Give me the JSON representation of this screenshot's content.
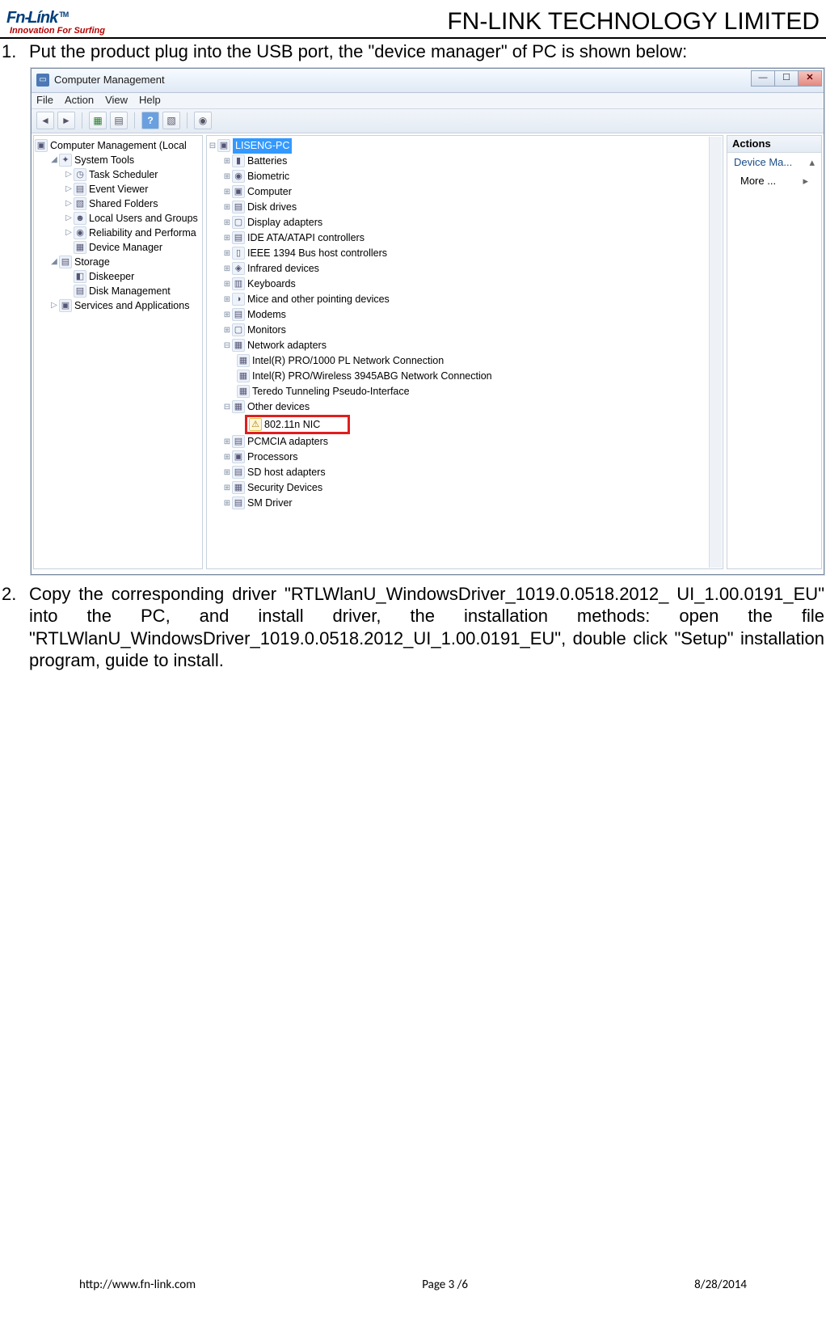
{
  "header": {
    "logo_text": "FN-LINK",
    "logo_tm": "TM",
    "logo_sub": "Innovation For Surfing",
    "company": "FN-LINK TECHNOLOGY LIMITED"
  },
  "steps": {
    "s1_num": "1.",
    "s1_text": "Put the product plug into the USB port, the \"device manager\" of PC is shown below:",
    "s2_num": "2.",
    "s2_text": "Copy the corresponding driver \"RTLWlanU_WindowsDriver_1019.0.0518.2012_ UI_1.00.0191_EU\" into the PC, and install driver, the installation methods: open the file \"RTLWlanU_WindowsDriver_1019.0.0518.2012_UI_1.00.0191_EU\", double click \"Setup\" installation program, guide to install."
  },
  "window": {
    "title": "Computer Management",
    "menu": {
      "file": "File",
      "action": "Action",
      "view": "View",
      "help": "Help"
    },
    "left_tree": {
      "root": "Computer Management (Local",
      "systools": "System Tools",
      "task": "Task Scheduler",
      "event": "Event Viewer",
      "shared": "Shared Folders",
      "users": "Local Users and Groups",
      "reliab": "Reliability and Performa",
      "devmgr": "Device Manager",
      "storage": "Storage",
      "diskeeper": "Diskeeper",
      "diskmgmt": "Disk Management",
      "services": "Services and Applications"
    },
    "devices": {
      "root": "LISENG-PC",
      "batteries": "Batteries",
      "biometric": "Biometric",
      "computer": "Computer",
      "disk": "Disk drives",
      "display": "Display adapters",
      "ide": "IDE ATA/ATAPI controllers",
      "ieee": "IEEE 1394 Bus host controllers",
      "infrared": "Infrared devices",
      "keyboards": "Keyboards",
      "mice": "Mice and other pointing devices",
      "modems": "Modems",
      "monitors": "Monitors",
      "network": "Network adapters",
      "net1": "Intel(R) PRO/1000 PL Network Connection",
      "net2": "Intel(R) PRO/Wireless 3945ABG Network Connection",
      "net3": "Teredo Tunneling Pseudo-Interface",
      "other": "Other devices",
      "nic": "802.11n NIC",
      "pcmcia": "PCMCIA adapters",
      "processors": "Processors",
      "sd": "SD host adapters",
      "security": "Security Devices",
      "sm": "SM Driver"
    },
    "actions": {
      "header": "Actions",
      "devma": "Device Ma...",
      "more": "More ...",
      "arrow": "▸"
    }
  },
  "footer": {
    "url": "http://www.fn-link.com",
    "page": "Page 3 /6",
    "date": "8/28/2014"
  }
}
